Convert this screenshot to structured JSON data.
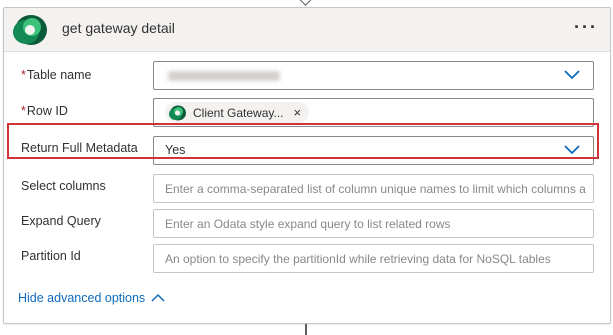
{
  "card": {
    "title": "get gateway detail",
    "more_label": "···"
  },
  "fields": {
    "table_name": {
      "label": "Table name",
      "required": "*",
      "value": ""
    },
    "row_id": {
      "label": "Row ID",
      "required": "*",
      "chip_text": "Client Gateway...",
      "chip_close": "×"
    },
    "return_full_metadata": {
      "label": "Return Full Metadata",
      "value": "Yes"
    },
    "select_columns": {
      "label": "Select columns",
      "placeholder": "Enter a comma-separated list of column unique names to limit which columns a"
    },
    "expand_query": {
      "label": "Expand Query",
      "placeholder": "Enter an Odata style expand query to list related rows"
    },
    "partition_id": {
      "label": "Partition Id",
      "placeholder": "An option to specify the partitionId while retrieving data for NoSQL tables"
    }
  },
  "advanced_toggle": {
    "label": "Hide advanced options"
  },
  "colors": {
    "accent": "#0f6cbd",
    "highlight_border": "#d13438",
    "required": "#a4262c"
  }
}
